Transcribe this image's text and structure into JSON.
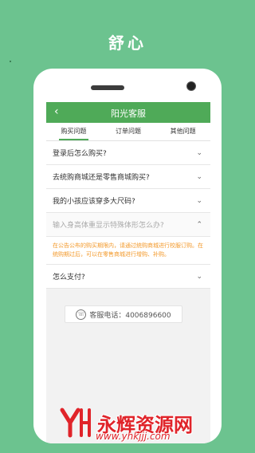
{
  "hero": {
    "title": "舒心"
  },
  "app": {
    "nav_title": "阳光客服",
    "back_icon": "‹",
    "tabs": [
      {
        "label": "购买问题",
        "active": true
      },
      {
        "label": "订单问题",
        "active": false
      },
      {
        "label": "其他问题",
        "active": false
      }
    ],
    "faq": [
      {
        "question": "登录后怎么购买?",
        "chevron": "⌄"
      },
      {
        "question": "去统购商城还是零售商城购买?",
        "chevron": "⌄"
      },
      {
        "question": "我的小孩应该穿多大尺码?",
        "chevron": "⌄"
      },
      {
        "question": "输入身高体重显示特殊体形怎么办?",
        "chevron": "⌃"
      },
      {
        "question": "怎么支付?",
        "chevron": "⌄"
      }
    ],
    "answer": "在公告公布的购买期限内，请通过统购商城进行校服订购。在统购期过后，可以在零售商城进行增购、补购。",
    "hotline": "客服电话：4006896600"
  },
  "watermark": {
    "brand": "永辉资源网",
    "url": "www.yhkjjj.com"
  },
  "colors": {
    "background": "#6cc38f",
    "nav": "#4faa58",
    "answer": "#f39a2c",
    "watermark": "#e0242a"
  }
}
